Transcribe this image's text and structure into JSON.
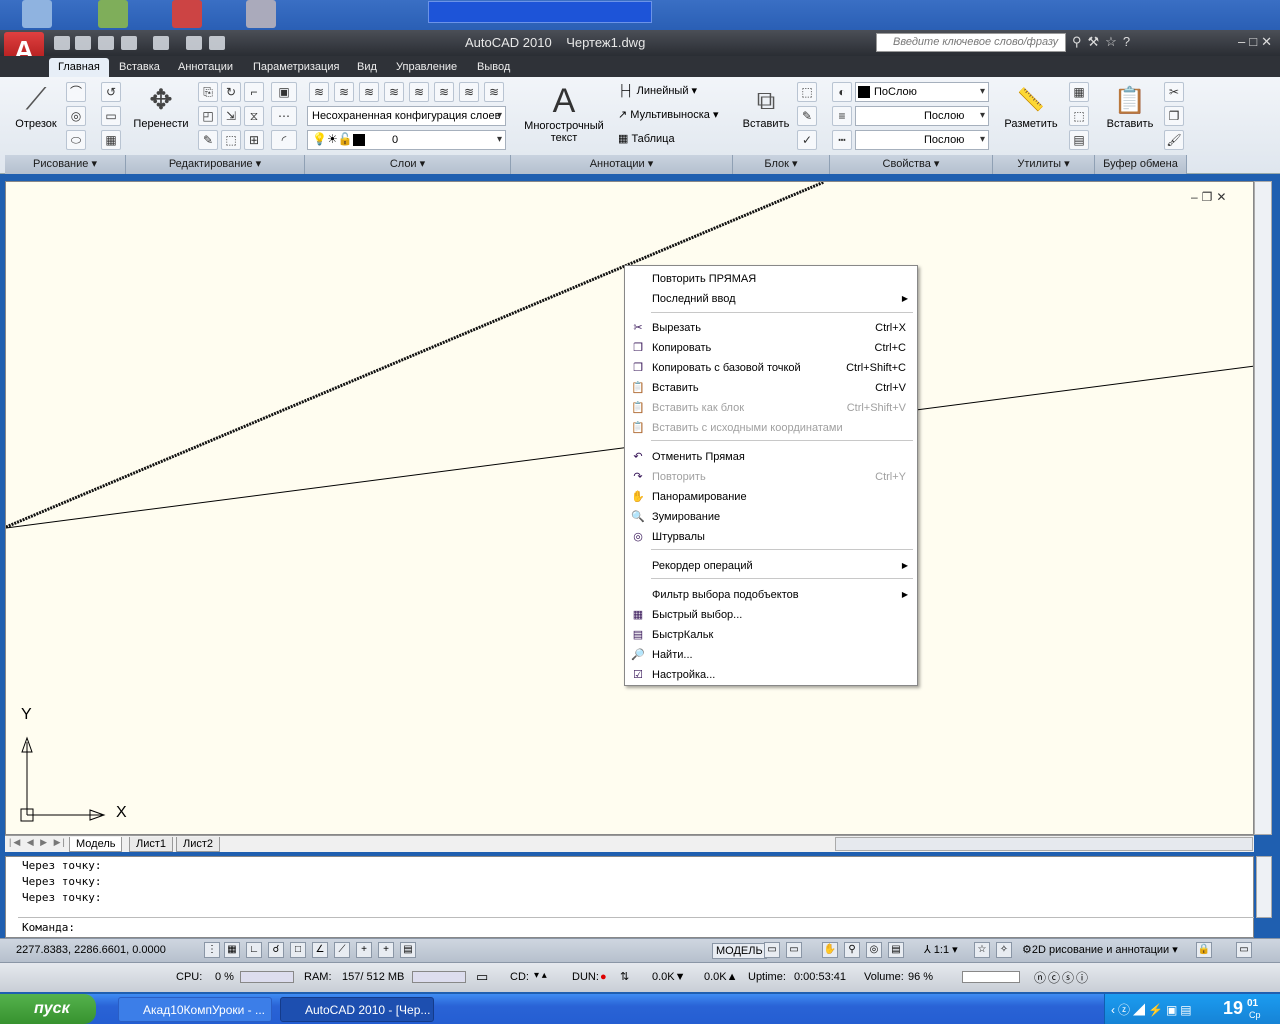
{
  "app": {
    "title": "AutoCAD 2010",
    "document": "Чертеж1.dwg",
    "search_placeholder": "Введите ключевое слово/фразу"
  },
  "ribbon_tabs": [
    "Главная",
    "Вставка",
    "Аннотации",
    "Параметризация",
    "Вид",
    "Управление",
    "Вывод"
  ],
  "ribbon": {
    "draw": {
      "line": "Отрезок",
      "panel": "Рисование"
    },
    "modify": {
      "move": "Перенести",
      "panel": "Редактирование"
    },
    "layers": {
      "config": "Несохраненная конфигурация слоев",
      "current_layer": "0",
      "panel": "Слои"
    },
    "annotations": {
      "mtext_line1": "Многострочный",
      "mtext_line2": "текст",
      "linear": "Линейный",
      "mleader": "Мультивыноска",
      "table": "Таблица",
      "panel": "Аннотации"
    },
    "block": {
      "insert": "Вставить",
      "panel": "Блок"
    },
    "properties": {
      "color": "ПоСлою",
      "linetype": "Послою",
      "lineweight": "Послою",
      "panel": "Свойства"
    },
    "utilities": {
      "measure": "Разметить",
      "panel": "Утилиты"
    },
    "clipboard": {
      "paste": "Вставить",
      "panel": "Буфер обмена"
    }
  },
  "context_menu": {
    "items": [
      {
        "label": "Повторить ПРЯМАЯ",
        "shortcut": "",
        "icon": "",
        "submenu": false,
        "disabled": false
      },
      {
        "label": "Последний ввод",
        "shortcut": "",
        "icon": "",
        "submenu": true,
        "disabled": false
      },
      {
        "label": "Вырезать",
        "shortcut": "Ctrl+X",
        "icon": "✂",
        "submenu": false,
        "disabled": false
      },
      {
        "label": "Копировать",
        "shortcut": "Ctrl+C",
        "icon": "❐",
        "submenu": false,
        "disabled": false
      },
      {
        "label": "Копировать с базовой точкой",
        "shortcut": "Ctrl+Shift+C",
        "icon": "❐",
        "submenu": false,
        "disabled": false
      },
      {
        "label": "Вставить",
        "shortcut": "Ctrl+V",
        "icon": "📋",
        "submenu": false,
        "disabled": false
      },
      {
        "label": "Вставить как блок",
        "shortcut": "Ctrl+Shift+V",
        "icon": "📋",
        "submenu": false,
        "disabled": true
      },
      {
        "label": "Вставить с исходными координатами",
        "shortcut": "",
        "icon": "📋",
        "submenu": false,
        "disabled": true
      },
      {
        "label": "Отменить Прямая",
        "shortcut": "",
        "icon": "↶",
        "submenu": false,
        "disabled": false
      },
      {
        "label": "Повторить",
        "shortcut": "Ctrl+Y",
        "icon": "↷",
        "submenu": false,
        "disabled": true
      },
      {
        "label": "Панорамирование",
        "shortcut": "",
        "icon": "✋",
        "submenu": false,
        "disabled": false
      },
      {
        "label": "Зумирование",
        "shortcut": "",
        "icon": "🔍",
        "submenu": false,
        "disabled": false
      },
      {
        "label": "Штурвалы",
        "shortcut": "",
        "icon": "◎",
        "submenu": false,
        "disabled": false
      },
      {
        "label": "Рекордер операций",
        "shortcut": "",
        "icon": "",
        "submenu": true,
        "disabled": false
      },
      {
        "label": "Фильтр выбора подобъектов",
        "shortcut": "",
        "icon": "",
        "submenu": true,
        "disabled": false
      },
      {
        "label": "Быстрый выбор...",
        "shortcut": "",
        "icon": "▦",
        "submenu": false,
        "disabled": false
      },
      {
        "label": "БыстрКальк",
        "shortcut": "",
        "icon": "▤",
        "submenu": false,
        "disabled": false
      },
      {
        "label": "Найти...",
        "shortcut": "",
        "icon": "🔎",
        "submenu": false,
        "disabled": false
      },
      {
        "label": "Настройка...",
        "shortcut": "",
        "icon": "☑",
        "submenu": false,
        "disabled": false
      }
    ]
  },
  "ucs": {
    "x": "X",
    "y": "Y"
  },
  "layout_tabs": [
    "Модель",
    "Лист1",
    "Лист2"
  ],
  "command": {
    "history": [
      "Через точку:",
      "Через точку:",
      "Через точку:"
    ],
    "prompt": "Команда:"
  },
  "status": {
    "coords": "2277.8383, 2286.6601, 0.0000",
    "model": "МОДЕЛЬ",
    "scale": "1:1",
    "workspace": "2D рисование и аннотации"
  },
  "perf": {
    "cpu_label": "CPU:",
    "cpu_value": "0 %",
    "ram_label": "RAM:",
    "ram_value": "157/ 512 MB",
    "cd_label": "CD:",
    "dun_label": "DUN:",
    "down": "0.0K",
    "up": "0.0K",
    "uptime_label": "Uptime:",
    "uptime_value": "0:00:53:41",
    "volume_label": "Volume:",
    "volume_value": "96 %"
  },
  "taskbar": {
    "start": "пуск",
    "tasks": [
      "Акад10КомпУроки - ...",
      "AutoCAD 2010 - [Чер..."
    ],
    "clock": "19",
    "clock_min": "01",
    "clock_day": "Ср"
  },
  "colors": {
    "canvas": "#fffdf0",
    "titlebar": "#2f3238",
    "taskbar": "#245ed2",
    "start": "#3c9a33"
  }
}
